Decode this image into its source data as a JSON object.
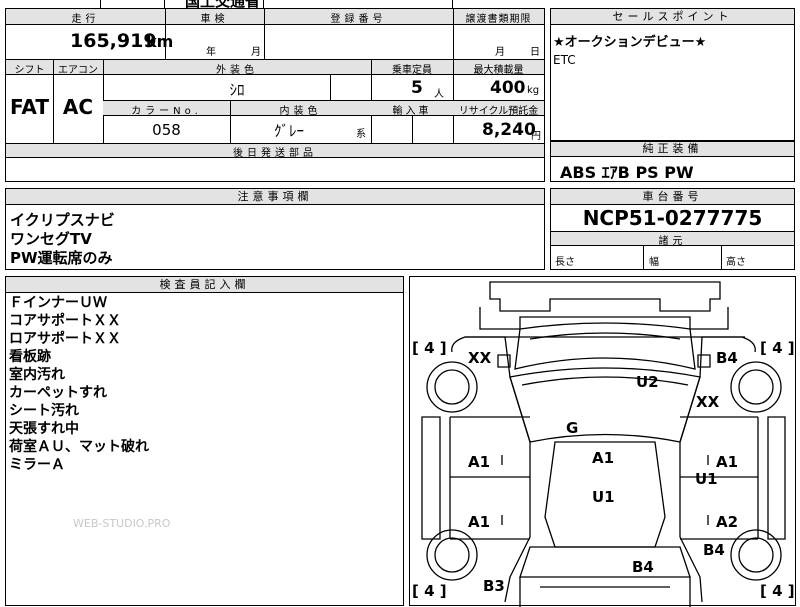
{
  "top_fragment": "国土交通省",
  "header": {
    "mileage_label": "走行",
    "inspection_label": "車検",
    "registration_label": "登録番号",
    "transfer_deadline_label": "譲渡書類期限",
    "sales_point_label": "セールスポイント",
    "mileage_value": "165,919",
    "mileage_unit": "km",
    "year_unit": "年",
    "month_unit": "月",
    "transfer_month_unit": "月",
    "transfer_day_unit": "日"
  },
  "sales_points": [
    "★オークションデビュー★",
    "ETC"
  ],
  "spec": {
    "shift_label": "シフト",
    "aircon_label": "エアコン",
    "exterior_color_label": "外装色",
    "capacity_label": "乗車定員",
    "max_load_label": "最大積載量",
    "shift_value": "FAT",
    "aircon_value": "AC",
    "exterior_color_value": "ｼﾛ",
    "capacity_value": "5",
    "capacity_unit": "人",
    "max_load_value": "400",
    "max_load_unit": "kg",
    "color_no_label": "カラーNo.",
    "interior_color_label": "内装色",
    "import_label": "輸入車",
    "recycle_label": "リサイクル預託金",
    "color_no_value": "058",
    "interior_color_value": "ｸﾞﾚｰ",
    "interior_color_suffix": "系",
    "recycle_value": "8,240",
    "recycle_unit": "円",
    "later_parts_label": "後日発送部品"
  },
  "standard_equipment": {
    "label": "純正装備",
    "value": "ABS ｴｱB PS PW"
  },
  "notes": {
    "label": "注意事項欄",
    "lines": [
      "イクリプスナビ",
      "ワンセグTV",
      "PW運転席のみ"
    ]
  },
  "chassis": {
    "label": "車台番号",
    "value": "NCP51-0277775",
    "dims_label": "諸元",
    "length_label": "長さ",
    "width_label": "幅",
    "height_label": "高さ"
  },
  "inspector": {
    "label": "検査員記入欄",
    "lines": [
      "ＦインナーＵＷ",
      "コアサポートＸＸ",
      "ロアサポートＸＸ",
      "看板跡",
      "室内汚れ",
      "カーペットすれ",
      "シート汚れ",
      "天張すれ中",
      "荷室ＡＵ、マット破れ",
      "ミラーＡ"
    ]
  },
  "watermark": "WEB-STUDIO.PRO",
  "diagram": {
    "tire_tl": "[ 4 ]",
    "tire_tr": "[ 4 ]",
    "tire_bl": "[ 4 ]",
    "tire_br": "[ 4 ]",
    "marks": {
      "xx_front_left": "XX",
      "b4_front_right": "B4",
      "u2_hood": "U2",
      "xx_right_fender": "XX",
      "g_windshield": "G",
      "a1_left_front_door": "A1",
      "a1_roof": "A1",
      "a1_right_front_door": "A1",
      "u1_right": "U1",
      "u1_roof": "U1",
      "a1_left_rear_door": "A1",
      "a2_right_rear_door": "A2",
      "b4_right_rear": "B4",
      "b4_rear_center": "B4",
      "b3_rear_left": "B3"
    }
  }
}
